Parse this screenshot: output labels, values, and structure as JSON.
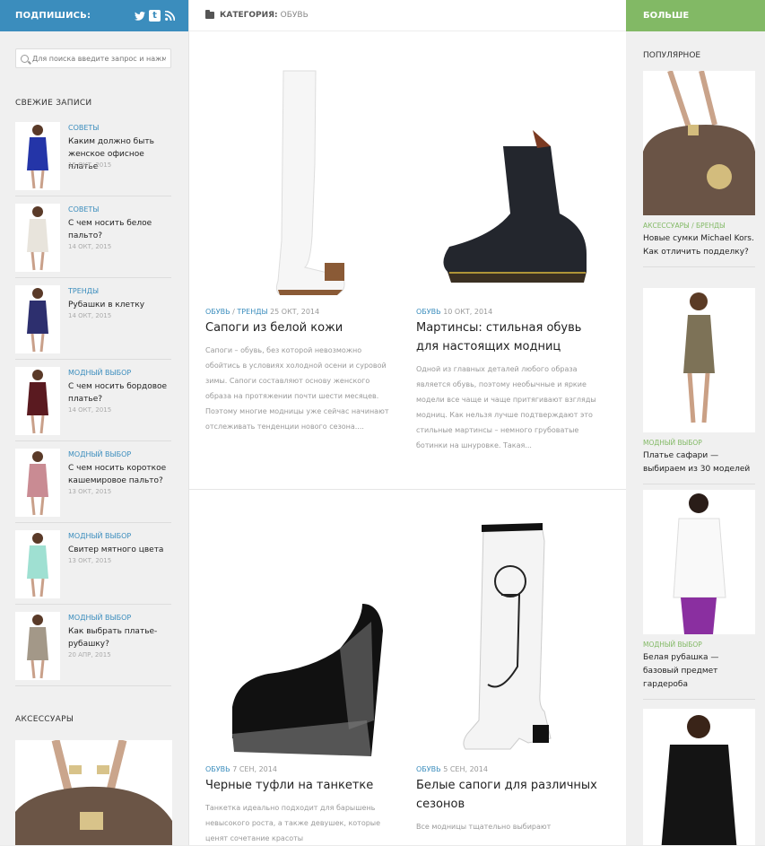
{
  "left": {
    "subscribe": "ПОДПИШИСЬ:",
    "social": [
      "twitter-icon",
      "tumblr-icon",
      "rss-icon"
    ],
    "search_placeholder": "Для поиска введите запрос и нажмите Enter",
    "recent_title": "Свежие записи",
    "recent": [
      {
        "cat": "Советы",
        "title": "Каким должно быть женское офисное платье",
        "date": "15 окт, 2015",
        "color": "#2435a8"
      },
      {
        "cat": "Советы",
        "title": "С чем носить белое пальто?",
        "date": "14 окт, 2015",
        "color": "#e8e4dc"
      },
      {
        "cat": "Тренды",
        "title": "Рубашки в клетку",
        "date": "14 окт, 2015",
        "color": "#2d2f6e"
      },
      {
        "cat": "Модный выбор",
        "title": "С чем носить бордовое платье?",
        "date": "14 окт, 2015",
        "color": "#5a1a20"
      },
      {
        "cat": "Модный выбор",
        "title": "С чем носить короткое кашемировое пальто?",
        "date": "13 окт, 2015",
        "color": "#c98b93"
      },
      {
        "cat": "Модный выбор",
        "title": "Свитер мятного цвета",
        "date": "13 окт, 2015",
        "color": "#9fe0d2"
      },
      {
        "cat": "Модный выбор",
        "title": "Как выбрать платье-рубашку?",
        "date": "20 апр, 2015",
        "color": "#a39888"
      }
    ],
    "acc_title": "Аксессуары"
  },
  "main": {
    "cat_label": "Категория:",
    "cat_value": "Обувь",
    "posts": [
      {
        "cats": "Обувь",
        "cats2": "Тренды",
        "date": "25 окт, 2014",
        "title": "Сапоги из белой кожи",
        "excerpt": "Сапоги – обувь, без которой невозможно обойтись в условиях холодной осени и суровой зимы. Сапоги составляют основу женского образа на протяжении почти шести месяцев. Поэтому многие модницы уже сейчас начинают отслеживать тенденции нового сезона...."
      },
      {
        "cats": "Обувь",
        "date": "10 окт, 2014",
        "title": "Мартинсы: стильная обувь для настоящих модниц",
        "excerpt": "Одной из главных деталей любого образа является обувь, поэтому необычные и яркие модели все чаще и чаще притягивают взгляды модниц. Как нельзя лучше подтверждают это стильные мартинсы – немного грубоватые ботинки на шнуровке. Такая..."
      },
      {
        "cats": "Обувь",
        "date": "7 сен, 2014",
        "title": "Черные туфли на танкетке",
        "excerpt": "Танкетка идеально подходит для барышень невысокого роста, а также девушек, которые ценят сочетание красоты"
      },
      {
        "cats": "Обувь",
        "date": "5 сен, 2014",
        "title": "Белые сапоги для различных сезонов",
        "excerpt": "Все модницы тщательно выбирают"
      }
    ]
  },
  "right": {
    "more": "БОЛЬШЕ",
    "popular_title": "Популярное",
    "items": [
      {
        "cat": "Аксессуары / Бренды",
        "title": "Новые сумки Michael Kors. Как отличить подделку?"
      },
      {
        "cat": "Модный выбор",
        "title": "Платье сафари — выбираем из 30 моделей"
      },
      {
        "cat": "Модный выбор",
        "title": "Белая рубашка — базовый предмет гардероба"
      }
    ]
  }
}
